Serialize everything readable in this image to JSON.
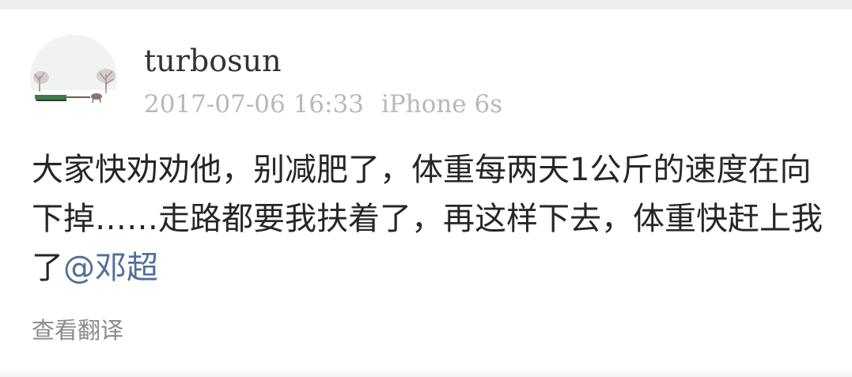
{
  "post": {
    "username": "turbosun",
    "timestamp": "2017-07-06 16:33",
    "device": "iPhone 6s",
    "text": "大家快劝劝他，别减肥了，体重每两天1公斤的速度在向下掉……走路都要我扶着了，再这样下去，体重快赶上我了",
    "mention": "@邓超",
    "translate_label": "查看翻译"
  },
  "colors": {
    "mention": "#4f6f9a",
    "meta": "#b8b8b8",
    "body_text": "#262626",
    "translate": "#8a8a8a"
  }
}
